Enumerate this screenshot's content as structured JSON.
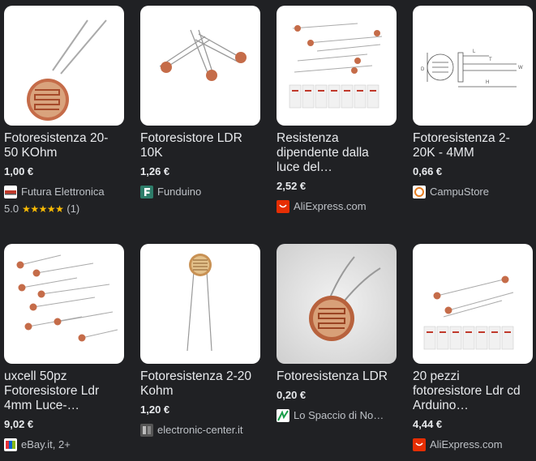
{
  "products": [
    {
      "title": "Fotoresistenza 20-50 KOhm",
      "price": "1,00 €",
      "merchant": "Futura Elettronica",
      "favicon": "futura-favicon",
      "rating_value": "5.0",
      "rating_stars": "★★★★★",
      "rating_count": "(1)"
    },
    {
      "title": "Fotoresistore LDR 10K",
      "price": "1,26 €",
      "merchant": "Funduino",
      "favicon": "funduino-favicon"
    },
    {
      "title": "Resistenza dipendente dalla luce del…",
      "price": "2,52 €",
      "merchant": "AliExpress.com",
      "favicon": "aliexpress-favicon"
    },
    {
      "title": "Fotoresistenza 2-20K - 4MM",
      "price": "0,66 €",
      "merchant": "CampuStore",
      "favicon": "campustore-favicon"
    },
    {
      "title": "uxcell 50pz Fotoresistore Ldr 4mm Luce-…",
      "price": "9,02 €",
      "merchant": "eBay.it, 2+",
      "favicon": "ebay-favicon"
    },
    {
      "title": "Fotoresistenza 2-20 Kohm",
      "price": "1,20 €",
      "merchant": "electronic-center.it",
      "favicon": "electronic-center-favicon"
    },
    {
      "title": "Fotoresistenza LDR",
      "price": "0,20 €",
      "merchant": "Lo Spaccio di No…",
      "favicon": "lo-spaccio-favicon"
    },
    {
      "title": "20 pezzi fotoresistore Ldr cd Arduino…",
      "price": "4,44 €",
      "merchant": "AliExpress.com",
      "favicon": "aliexpress-favicon"
    }
  ],
  "drawing_labels": {
    "dim_l": "L",
    "dim_h": "H",
    "dim_d": "D",
    "dim_w": "W",
    "dim_t": "T"
  },
  "colors": {
    "background": "#202124",
    "text": "#e8eaed",
    "secondary_text": "#bdc1c6",
    "star": "#fbbc04",
    "aliexpress": "#e62e04"
  }
}
